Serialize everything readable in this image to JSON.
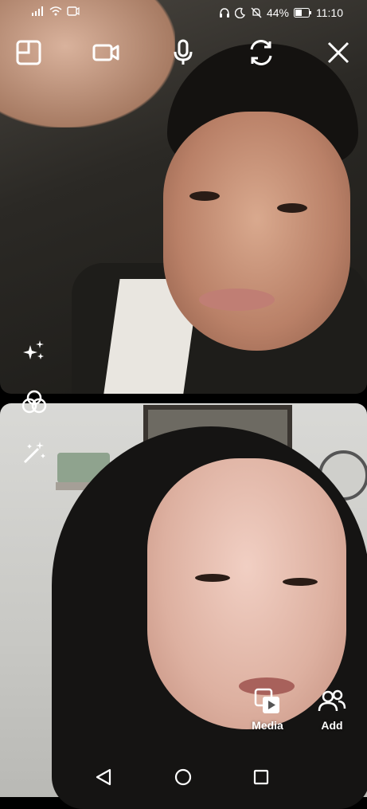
{
  "status_bar": {
    "battery_percent": "44%",
    "time": "11:10",
    "icons": [
      "signal-icon",
      "wifi-icon",
      "screen-record-icon",
      "headset-icon",
      "moon-icon",
      "mute-icon",
      "battery-icon"
    ]
  },
  "call_controls": {
    "icons": [
      "layout-icon",
      "video-camera-icon",
      "microphone-icon",
      "switch-camera-icon",
      "close-icon"
    ]
  },
  "side_tools": {
    "icons": [
      "sparkles-icon",
      "filters-icon",
      "magic-wand-icon"
    ]
  },
  "actions": {
    "media_label": "Media",
    "add_label": "Add"
  },
  "nav_bar": {
    "icons": [
      "back-icon",
      "home-icon",
      "recents-icon"
    ]
  }
}
